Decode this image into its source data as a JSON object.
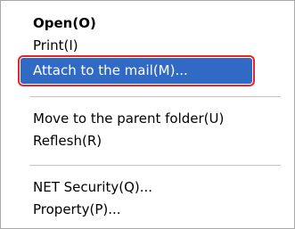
{
  "context_menu": {
    "groups": [
      {
        "items": [
          {
            "label": "Open(O)",
            "default": true
          },
          {
            "label": "Print(I)"
          },
          {
            "label": "Attach to the mail(M)...",
            "highlighted": true
          }
        ]
      },
      {
        "items": [
          {
            "label": "Move to the parent folder(U)"
          },
          {
            "label": "Reflesh(R)"
          }
        ]
      },
      {
        "items": [
          {
            "label": "NET Security(Q)..."
          },
          {
            "label": "Property(P)..."
          }
        ]
      }
    ]
  },
  "colors": {
    "highlight": "#316ac5",
    "highlight_border": "#e3262b",
    "separator": "#c5c5c5"
  }
}
